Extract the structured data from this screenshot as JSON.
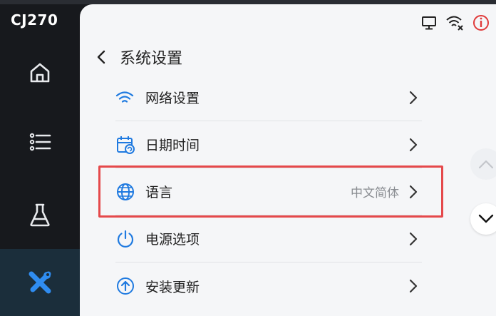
{
  "brand": "CJ270",
  "sidebar": {
    "items": [
      {
        "name": "home",
        "icon": "home-icon",
        "active": false
      },
      {
        "name": "list",
        "icon": "list-icon",
        "active": false
      },
      {
        "name": "experiment",
        "icon": "flask-icon",
        "active": false
      },
      {
        "name": "tools",
        "icon": "tools-icon",
        "active": true
      }
    ]
  },
  "status_icons": [
    "monitor-icon",
    "wifi-off-icon",
    "alert-icon"
  ],
  "header": {
    "title": "系统设置"
  },
  "settings": [
    {
      "label": "网络设置",
      "icon": "wifi-icon",
      "value": ""
    },
    {
      "label": "日期时间",
      "icon": "calendar-icon",
      "value": ""
    },
    {
      "label": "语言",
      "icon": "globe-icon",
      "value": "中文简体"
    },
    {
      "label": "电源选项",
      "icon": "power-icon",
      "value": ""
    },
    {
      "label": "安装更新",
      "icon": "update-icon",
      "value": ""
    }
  ],
  "colors": {
    "accent": "#1f7ae0",
    "rail_bg": "#17191d",
    "active_rail": "#1b2e3b",
    "highlight": "#e5494b",
    "panel_bg": "#f5f6f8"
  }
}
